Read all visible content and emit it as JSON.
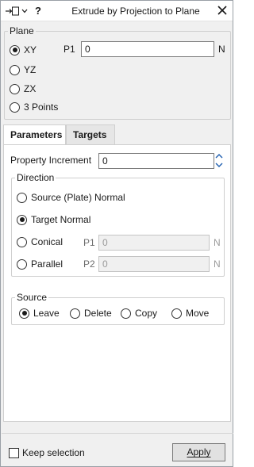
{
  "window": {
    "title": "Extrude by Projection to Plane",
    "help_label": "?"
  },
  "plane": {
    "legend": "Plane",
    "options": [
      {
        "label": "XY",
        "selected": true
      },
      {
        "label": "YZ",
        "selected": false
      },
      {
        "label": "ZX",
        "selected": false
      },
      {
        "label": "3 Points",
        "selected": false
      }
    ],
    "p1_label": "P1",
    "p1_value": "0",
    "p1_unit": "N"
  },
  "tabs": [
    {
      "label": "Parameters",
      "active": true
    },
    {
      "label": "Targets",
      "active": false
    }
  ],
  "parameters": {
    "property_increment_label": "Property Increment",
    "property_increment_value": "0",
    "direction": {
      "legend": "Direction",
      "options": [
        {
          "label": "Source (Plate) Normal",
          "selected": false
        },
        {
          "label": "Target Normal",
          "selected": true
        },
        {
          "label": "Conical",
          "selected": false
        },
        {
          "label": "Parallel",
          "selected": false
        }
      ],
      "p1_label": "P1",
      "p1_value": "0",
      "p1_unit": "N",
      "p2_label": "P2",
      "p2_value": "0",
      "p2_unit": "N"
    },
    "source": {
      "legend": "Source",
      "options": [
        {
          "label": "Leave",
          "selected": true
        },
        {
          "label": "Delete",
          "selected": false
        },
        {
          "label": "Copy",
          "selected": false
        },
        {
          "label": "Move",
          "selected": false
        }
      ]
    }
  },
  "footer": {
    "keep_selection_label": "Keep selection",
    "keep_selection_checked": false,
    "apply_label": "Apply"
  }
}
